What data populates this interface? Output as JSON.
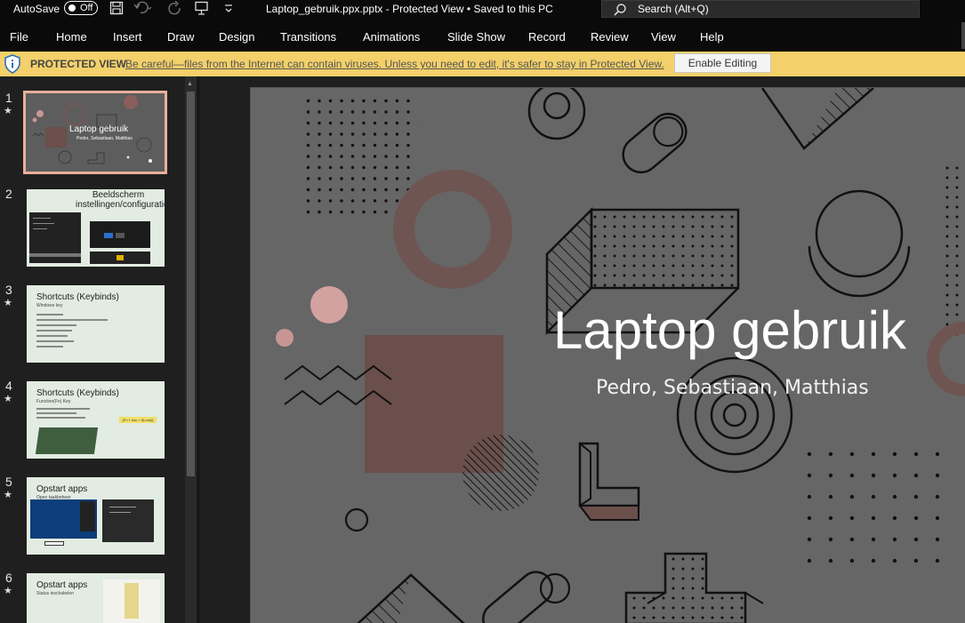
{
  "titlebar": {
    "autosave_label": "AutoSave",
    "autosave_state": "Off",
    "document_title": "Laptop_gebruik.ppx.pptx  -  Protected View • Saved to this PC",
    "search_placeholder": "Search (Alt+Q)",
    "icons": [
      "save-icon",
      "undo-icon",
      "redo-icon",
      "present-icon",
      "customize-qat-icon",
      "search-icon"
    ]
  },
  "ribbon": {
    "tabs": [
      "File",
      "Home",
      "Insert",
      "Draw",
      "Design",
      "Transitions",
      "Animations",
      "Slide Show",
      "Record",
      "Review",
      "View",
      "Help"
    ]
  },
  "protected_view": {
    "label": "PROTECTED VIEW",
    "message": "Be careful—files from the Internet can contain viruses. Unless you need to edit, it's safer to stay in Protected View.",
    "button": "Enable Editing",
    "icon": "shield-icon"
  },
  "slides": [
    {
      "number": "1",
      "star": "★",
      "title": "Laptop gebruik",
      "subtitle": "Pedro, Sebastiaan, Matthias"
    },
    {
      "number": "2",
      "star": "",
      "title": "Beeldscherm instellingen/configuratie",
      "subtitle": ""
    },
    {
      "number": "3",
      "star": "★",
      "title": "Shortcuts (Keybinds)",
      "subtitle": "Windows key"
    },
    {
      "number": "4",
      "star": "★",
      "title": "Shortcuts (Keybinds)",
      "subtitle": "Function(Fn) Key",
      "badge": "(Fn + esc = f(Lock))"
    },
    {
      "number": "5",
      "star": "★",
      "title": "Opstart apps",
      "subtitle": "Open taakbeheer"
    },
    {
      "number": "6",
      "star": "★",
      "title": "Opstart apps",
      "subtitle": "Status inschakelen"
    }
  ],
  "current_slide": {
    "title": "Laptop gebruik",
    "subtitle": "Pedro, Sebastiaan, Matthias"
  },
  "colors": {
    "protected_bar": "#f3d06a",
    "selected_thumb_border": "#e8b09b",
    "slide_bg": "#666666",
    "accent_pink": "#c89595",
    "accent_brown": "#6a4f4b"
  }
}
